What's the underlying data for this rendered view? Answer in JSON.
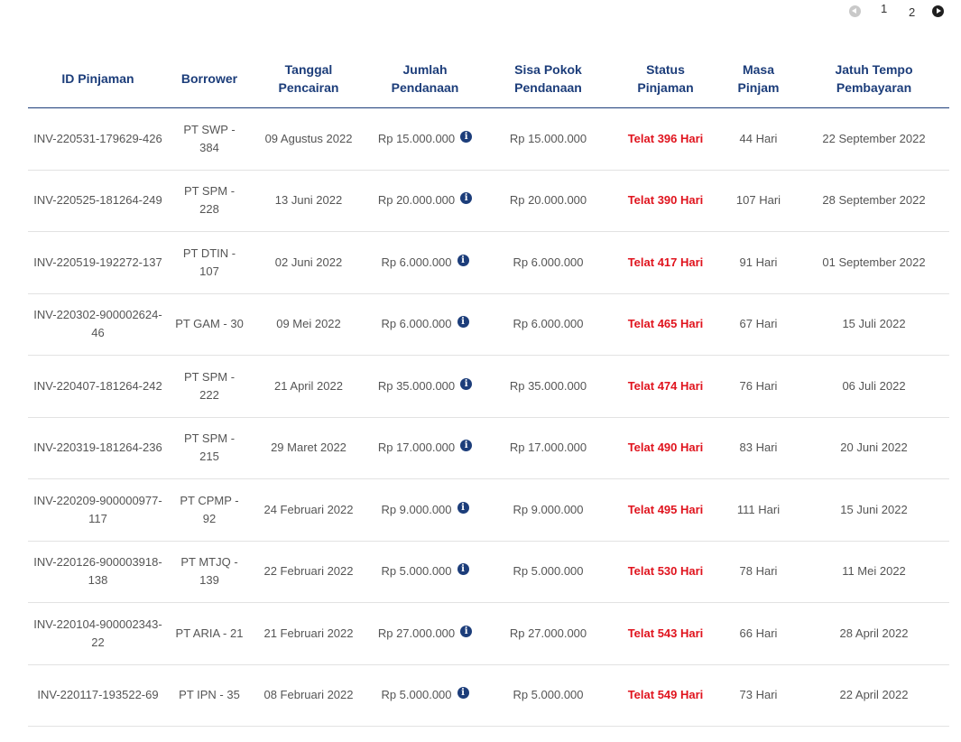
{
  "pagination": {
    "pages": [
      "1",
      "2"
    ],
    "current_page": "1"
  },
  "table": {
    "headers": {
      "id": "ID Pinjaman",
      "borrower": "Borrower",
      "disbursement_date": "Tanggal Pencairan",
      "funding_amount": "Jumlah Pendanaan",
      "remaining_principal": "Sisa Pokok Pendanaan",
      "loan_status": "Status Pinjaman",
      "loan_period": "Masa Pinjam",
      "due_date": "Jatuh Tempo Pembayaran"
    },
    "rows": [
      {
        "id": "INV-220531-179629-426",
        "borrower": "PT SWP - 384",
        "disbursement_date": "09 Agustus 2022",
        "funding_amount": "Rp 15.000.000",
        "remaining_principal": "Rp 15.000.000",
        "status": "Telat 396 Hari",
        "period": "44 Hari",
        "due_date": "22 September 2022"
      },
      {
        "id": "INV-220525-181264-249",
        "borrower": "PT SPM - 228",
        "disbursement_date": "13 Juni 2022",
        "funding_amount": "Rp 20.000.000",
        "remaining_principal": "Rp 20.000.000",
        "status": "Telat 390 Hari",
        "period": "107 Hari",
        "due_date": "28 September 2022"
      },
      {
        "id": "INV-220519-192272-137",
        "borrower": "PT DTIN - 107",
        "disbursement_date": "02 Juni 2022",
        "funding_amount": "Rp 6.000.000",
        "remaining_principal": "Rp 6.000.000",
        "status": "Telat 417 Hari",
        "period": "91 Hari",
        "due_date": "01 September 2022"
      },
      {
        "id": "INV-220302-900002624-46",
        "borrower": "PT GAM - 30",
        "disbursement_date": "09 Mei 2022",
        "funding_amount": "Rp 6.000.000",
        "remaining_principal": "Rp 6.000.000",
        "status": "Telat 465 Hari",
        "period": "67 Hari",
        "due_date": "15 Juli 2022"
      },
      {
        "id": "INV-220407-181264-242",
        "borrower": "PT SPM - 222",
        "disbursement_date": "21 April 2022",
        "funding_amount": "Rp 35.000.000",
        "remaining_principal": "Rp 35.000.000",
        "status": "Telat 474 Hari",
        "period": "76 Hari",
        "due_date": "06 Juli 2022"
      },
      {
        "id": "INV-220319-181264-236",
        "borrower": "PT SPM - 215",
        "disbursement_date": "29 Maret 2022",
        "funding_amount": "Rp 17.000.000",
        "remaining_principal": "Rp 17.000.000",
        "status": "Telat 490 Hari",
        "period": "83 Hari",
        "due_date": "20 Juni 2022"
      },
      {
        "id": "INV-220209-900000977-117",
        "borrower": "PT CPMP - 92",
        "disbursement_date": "24 Februari 2022",
        "funding_amount": "Rp 9.000.000",
        "remaining_principal": "Rp 9.000.000",
        "status": "Telat 495 Hari",
        "period": "111 Hari",
        "due_date": "15 Juni 2022"
      },
      {
        "id": "INV-220126-900003918-138",
        "borrower": "PT MTJQ - 139",
        "disbursement_date": "22 Februari 2022",
        "funding_amount": "Rp 5.000.000",
        "remaining_principal": "Rp 5.000.000",
        "status": "Telat 530 Hari",
        "period": "78 Hari",
        "due_date": "11 Mei 2022"
      },
      {
        "id": "INV-220104-900002343-22",
        "borrower": "PT ARIA - 21",
        "disbursement_date": "21 Februari 2022",
        "funding_amount": "Rp 27.000.000",
        "remaining_principal": "Rp 27.000.000",
        "status": "Telat 543 Hari",
        "period": "66 Hari",
        "due_date": "28 April 2022"
      },
      {
        "id": "INV-220117-193522-69",
        "borrower": "PT IPN - 35",
        "disbursement_date": "08 Februari 2022",
        "funding_amount": "Rp 5.000.000",
        "remaining_principal": "Rp 5.000.000",
        "status": "Telat 549 Hari",
        "period": "73 Hari",
        "due_date": "22 April 2022"
      }
    ]
  },
  "icons": {
    "prev": "chevron-left-circle-icon",
    "next": "chevron-right-circle-icon",
    "info": "info-circle-icon"
  },
  "colors": {
    "header_text": "#1c3d7a",
    "status_late": "#e0141e",
    "body_text": "#555555"
  }
}
